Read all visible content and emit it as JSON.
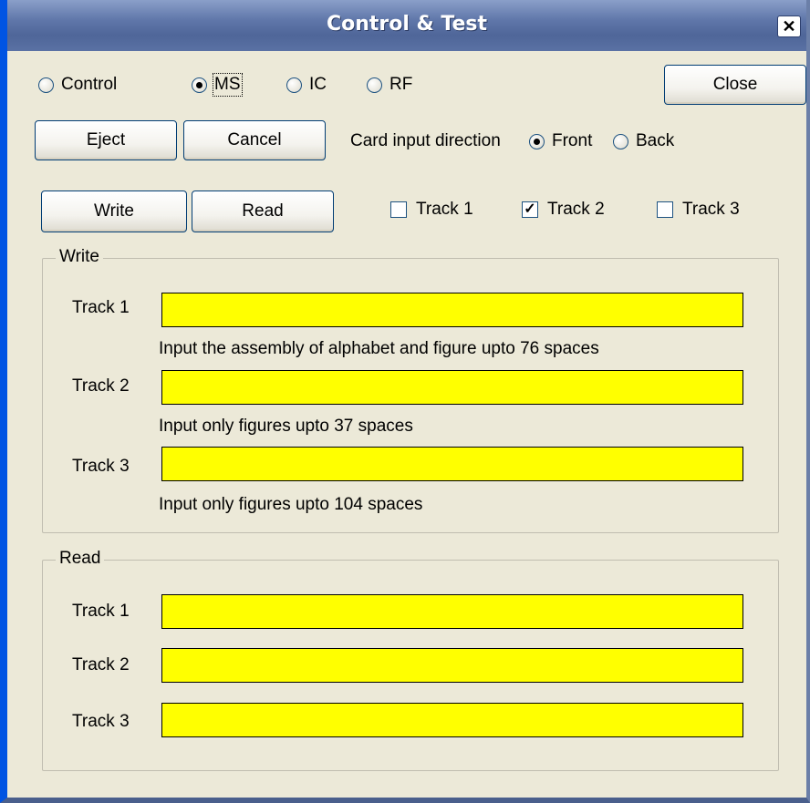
{
  "window": {
    "title": "Control & Test",
    "close_glyph": "✕"
  },
  "mode": {
    "options": [
      "Control",
      "MS",
      "IC",
      "RF"
    ],
    "selected": "MS"
  },
  "buttons": {
    "close": "Close",
    "eject": "Eject",
    "cancel": "Cancel",
    "write": "Write",
    "read": "Read"
  },
  "card_direction": {
    "label": "Card input direction",
    "options": [
      "Front",
      "Back"
    ],
    "selected": "Front"
  },
  "tracks_select": [
    {
      "label": "Track 1",
      "checked": false
    },
    {
      "label": "Track 2",
      "checked": true
    },
    {
      "label": "Track 3",
      "checked": false
    }
  ],
  "write_group": {
    "title": "Write",
    "tracks": [
      {
        "label": "Track 1",
        "value": "",
        "hint": "Input the assembly of alphabet and figure upto 76 spaces"
      },
      {
        "label": "Track 2",
        "value": "",
        "hint": "Input only figures upto 37 spaces"
      },
      {
        "label": "Track 3",
        "value": "",
        "hint": "Input only figures upto 104 spaces"
      }
    ]
  },
  "read_group": {
    "title": "Read",
    "tracks": [
      {
        "label": "Track 1",
        "value": ""
      },
      {
        "label": "Track 2",
        "value": ""
      },
      {
        "label": "Track 3",
        "value": ""
      }
    ]
  },
  "colors": {
    "field_background": "#ffff00",
    "titlebar": "#5f76a9",
    "window_background": "#ece9d8"
  },
  "check_glyph": "✓"
}
